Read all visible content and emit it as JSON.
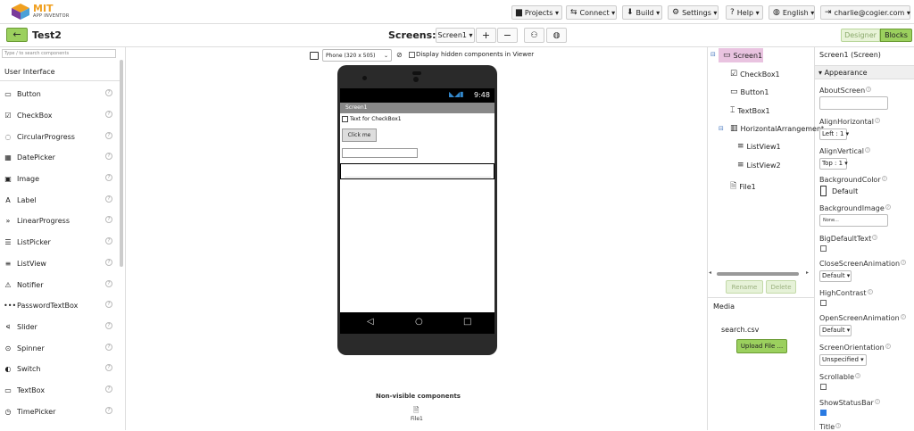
{
  "app": {
    "logo_title": "MIT",
    "logo_subtitle": "APP INVENTOR"
  },
  "topmenu": {
    "projects": "Projects ▾",
    "connect": "Connect ▾",
    "build": "Build ▾",
    "settings": "Settings ▾",
    "help": "Help ▾",
    "language": "English ▾",
    "account": "charlie@cogier.com ▾"
  },
  "toolbar": {
    "project_name": "Test2",
    "screens_label": "Screens:",
    "screen_select": "Screen1 ▾",
    "add_screen": "+",
    "remove_screen": "−",
    "designer": "Designer",
    "blocks": "Blocks"
  },
  "palette": {
    "search_placeholder": "Type / to search components",
    "category": "User Interface",
    "items": [
      {
        "label": "Button",
        "icon": "▭"
      },
      {
        "label": "CheckBox",
        "icon": "☑"
      },
      {
        "label": "CircularProgress",
        "icon": "◌"
      },
      {
        "label": "DatePicker",
        "icon": "▦"
      },
      {
        "label": "Image",
        "icon": "▣"
      },
      {
        "label": "Label",
        "icon": "A"
      },
      {
        "label": "LinearProgress",
        "icon": "»"
      },
      {
        "label": "ListPicker",
        "icon": "☰"
      },
      {
        "label": "ListView",
        "icon": "≡"
      },
      {
        "label": "Notifier",
        "icon": "⚠"
      },
      {
        "label": "PasswordTextBox",
        "icon": "•••"
      },
      {
        "label": "Slider",
        "icon": "⪨"
      },
      {
        "label": "Spinner",
        "icon": "⊙"
      },
      {
        "label": "Switch",
        "icon": "◐"
      },
      {
        "label": "TextBox",
        "icon": "▭"
      },
      {
        "label": "TimePicker",
        "icon": "◷"
      }
    ]
  },
  "viewer": {
    "phone_size": "Phone (320 x 505)",
    "phone_size_caret": "⌄",
    "hidden_label": "Display hidden components in Viewer",
    "status_time": "9:48",
    "screen_title": "Screen1",
    "checkbox_text": "Text for CheckBox1",
    "button_text": "Click me",
    "nonvisible_label": "Non-visible components",
    "nonvisible_file": "File1"
  },
  "tree": {
    "screen": "Screen1",
    "checkbox": "CheckBox1",
    "button": "Button1",
    "textbox": "TextBox1",
    "harrangement": "HorizontalArrangement",
    "listview1": "ListView1",
    "listview2": "ListView2",
    "file": "File1",
    "rename": "Rename",
    "delete": "Delete"
  },
  "media": {
    "title": "Media",
    "file": "search.csv",
    "upload": "Upload File ..."
  },
  "properties": {
    "title": "Screen1 (Screen)",
    "section": "Appearance",
    "about_screen": "AboutScreen",
    "align_horizontal": "AlignHorizontal",
    "align_horizontal_value": "Left : 1 ▾",
    "align_vertical": "AlignVertical",
    "align_vertical_value": "Top : 1 ▾",
    "background_color": "BackgroundColor",
    "background_color_value": "Default",
    "background_image": "BackgroundImage",
    "background_image_value": "None...",
    "big_default_text": "BigDefaultText",
    "close_animation": "CloseScreenAnimation",
    "close_animation_value": "Default ▾",
    "high_contrast": "HighContrast",
    "open_animation": "OpenScreenAnimation",
    "open_animation_value": "Default ▾",
    "orientation": "ScreenOrientation",
    "orientation_value": "Unspecified ▾",
    "scrollable": "Scrollable",
    "show_status_bar": "ShowStatusBar",
    "title_prop": "Title"
  },
  "colors": {
    "accent_green": "#9bd05e",
    "selection_pink": "#e9c3e0",
    "link_blue": "#4a7ac0"
  }
}
